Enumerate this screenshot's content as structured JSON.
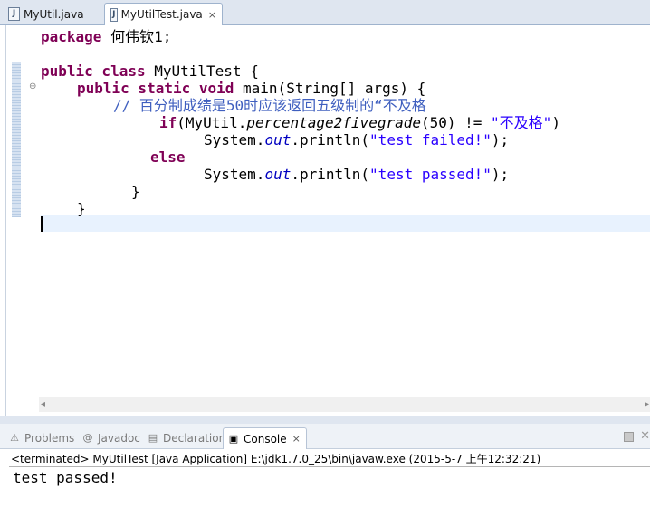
{
  "editor_tabs": [
    {
      "label": "MyUtil.java",
      "icon": "java-file-icon",
      "active": false
    },
    {
      "label": "MyUtilTest.java",
      "icon": "java-file-icon",
      "active": true,
      "close": "×"
    }
  ],
  "code": {
    "l1_kw": "package",
    "l1_rest": " 何伟钦1;",
    "l3_kw": "public class",
    "l3_rest": " MyUtilTest {",
    "l4_kw": "public static void",
    "l4_rest": " main(String[] args) {",
    "l5_comment": "// 百分制成绩是50时应该返回五级制的“不及格",
    "l6_kw": "if",
    "l6_a": "(MyUtil.",
    "l6_method": "percentage2fivegrade",
    "l6_b": "(50) != ",
    "l6_str": "\"不及格\"",
    "l6_c": ")",
    "l7_a": "System.",
    "l7_field": "out",
    "l7_b": ".println(",
    "l7_str": "\"test failed!\"",
    "l7_c": ");",
    "l8_kw": "else",
    "l9_a": "System.",
    "l9_field": "out",
    "l9_b": ".println(",
    "l9_str": "\"test passed!\"",
    "l9_c": ");",
    "l10": "}",
    "l11": "}"
  },
  "panel_tabs": [
    {
      "label": "Problems",
      "icon": "problems-icon",
      "glyph": "⚠"
    },
    {
      "label": "Javadoc",
      "icon": "javadoc-icon",
      "glyph": "@"
    },
    {
      "label": "Declaration",
      "icon": "declaration-icon",
      "glyph": "▤"
    },
    {
      "label": "Console",
      "icon": "console-icon",
      "glyph": "▣",
      "active": true,
      "close": "×"
    }
  ],
  "console": {
    "status": "<terminated> MyUtilTest [Java Application] E:\\jdk1.7.0_25\\bin\\javaw.exe (2015-5-7 上午12:32:21)",
    "output": "test passed!"
  },
  "colors": {
    "keyword": "#7f0055",
    "comment": "#3f5fbf",
    "string": "#2a00ff",
    "field": "#0000c0",
    "current_line": "#e8f2fe"
  }
}
